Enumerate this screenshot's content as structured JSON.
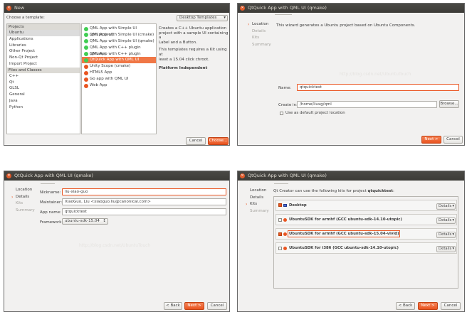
{
  "win1": {
    "title": "New",
    "choose_label": "Choose a template:",
    "template_filter": "Desktop Templates",
    "projects_header": "Projects",
    "projects": [
      "Ubuntu",
      "Applications",
      "Libraries",
      "Other Project",
      "Non-Qt Project",
      "Import Project"
    ],
    "files_header": "Files and Classes",
    "files": [
      "C++",
      "Qt",
      "GLSL",
      "General",
      "Java",
      "Python"
    ],
    "templates": [
      "QML App with Simple UI (qmlproject)",
      "QML App with Simple UI (cmake)",
      "QML App with Simple UI (qmake)",
      "QML App with C++ plugin (qmake)",
      "QML App with C++ plugin (cmake)",
      "QtQuick App with QML UI (qmake)",
      "Unity Scope (cmake)",
      "HTML5 App",
      "Go app with QML UI",
      "Web App"
    ],
    "description": [
      "Creates a C++ Ubuntu application",
      "project with a sample UI containing a",
      "Label and a Button.",
      "",
      "This templates requires a Kit using at",
      "least a 15.04 click chroot."
    ],
    "platform": "Platform Independent",
    "cancel": "Cancel",
    "choose": "Choose..."
  },
  "win2": {
    "title": "QtQuick App with QML UI (qmake)",
    "steps": [
      "Location",
      "Details",
      "Kits",
      "Summary"
    ],
    "intro": "This wizard generates a Ubuntu project based on Ubuntu Components.",
    "name_label": "Name:",
    "name_value": "qtquicktest",
    "create_label": "Create in:",
    "create_value": "/home/liuxg/qml",
    "browse": "Browse...",
    "default_loc": "Use as default project location",
    "next": "Next >",
    "cancel": "Cancel"
  },
  "win3": {
    "title": "QtQuick App with QML UI (qmake)",
    "steps": [
      "Location",
      "Details",
      "Kits",
      "Summary"
    ],
    "nickname_label": "Nickname:",
    "nickname_value": "liu-xiao-guo",
    "maintainer_label": "Maintainer:",
    "maintainer_value": "XiaoGuo, Liu <xiaoguo.liu@canonical.com>",
    "appname_label": "App name:",
    "appname_value": "qtquicktest",
    "framework_label": "Framework:",
    "framework_value": "ubuntu-sdk-15.04",
    "back": "< Back",
    "next": "Next >",
    "cancel": "Cancel"
  },
  "win4": {
    "title": "QtQuick App with QML UI (qmake)",
    "steps": [
      "Location",
      "Details",
      "Kits",
      "Summary"
    ],
    "intro": "Qt Creator can use the following kits for project",
    "project": "qtquicktest",
    "kits": [
      "Desktop",
      "UbuntuSDK for armhf (GCC ubuntu-sdk-14.10-utopic)",
      "UbuntuSDK for armhf (GCC ubuntu-sdk-15.04-vivid)",
      "UbuntuSDK for i386 (GCC ubuntu-sdk-14.10-utopic)"
    ],
    "details": "Details",
    "back": "< Back",
    "next": "Next >",
    "cancel": "Cancel"
  },
  "watermark": "http://blog.csdn.net/UbuntuTouch",
  "colors": {
    "accent": "#e95420",
    "titlebar": "#3c3b37",
    "window": "#f2f1f0"
  }
}
